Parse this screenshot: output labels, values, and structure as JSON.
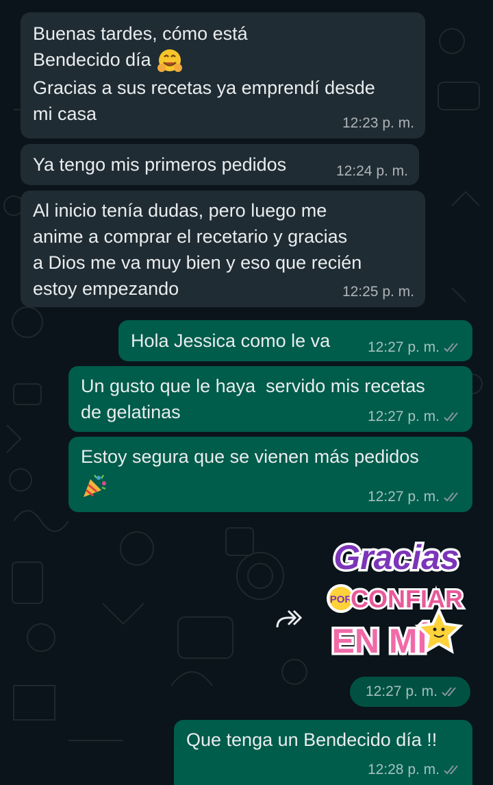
{
  "messages": [
    {
      "direction": "incoming",
      "lines": [
        "Buenas tardes, cómo está",
        "Bendecido día",
        "Gracias a sus recetas ya emprendí desde",
        "mi casa"
      ],
      "emoji": "hugging-face",
      "time": "12:23 p. m."
    },
    {
      "direction": "incoming",
      "lines": [
        "Ya tengo mis primeros pedidos"
      ],
      "time": "12:24 p. m."
    },
    {
      "direction": "incoming",
      "lines": [
        "Al inicio tenía dudas, pero luego me",
        "anime a comprar el recetario y gracias",
        "a Dios me va muy bien y eso que recién",
        "estoy empezando"
      ],
      "time": "12:25 p. m."
    },
    {
      "direction": "outgoing",
      "lines": [
        "Hola Jessica como le va"
      ],
      "time": "12:27 p. m.",
      "status": "read"
    },
    {
      "direction": "outgoing",
      "lines": [
        "Un gusto que le haya  servido mis recetas",
        "de gelatinas"
      ],
      "time": "12:27 p. m.",
      "status": "read"
    },
    {
      "direction": "outgoing",
      "lines": [
        "Estoy segura que se vienen más pedidos"
      ],
      "emoji": "party-popper",
      "time": "12:27 p. m.",
      "status": "read"
    },
    {
      "direction": "outgoing",
      "type": "sticker",
      "sticker_text": [
        "Gracias",
        "POR",
        "CONFIAR",
        "EN MÍ"
      ],
      "time": "12:27 p. m.",
      "status": "read"
    },
    {
      "direction": "outgoing",
      "lines": [
        "Que tenga un Bendecido día !!"
      ],
      "time": "12:28 p. m.",
      "status": "read"
    }
  ],
  "colors": {
    "background": "#0b141a",
    "incoming_bubble": "#202c33",
    "outgoing_bubble": "#005c4b",
    "read_ticks": "#8696a0"
  }
}
